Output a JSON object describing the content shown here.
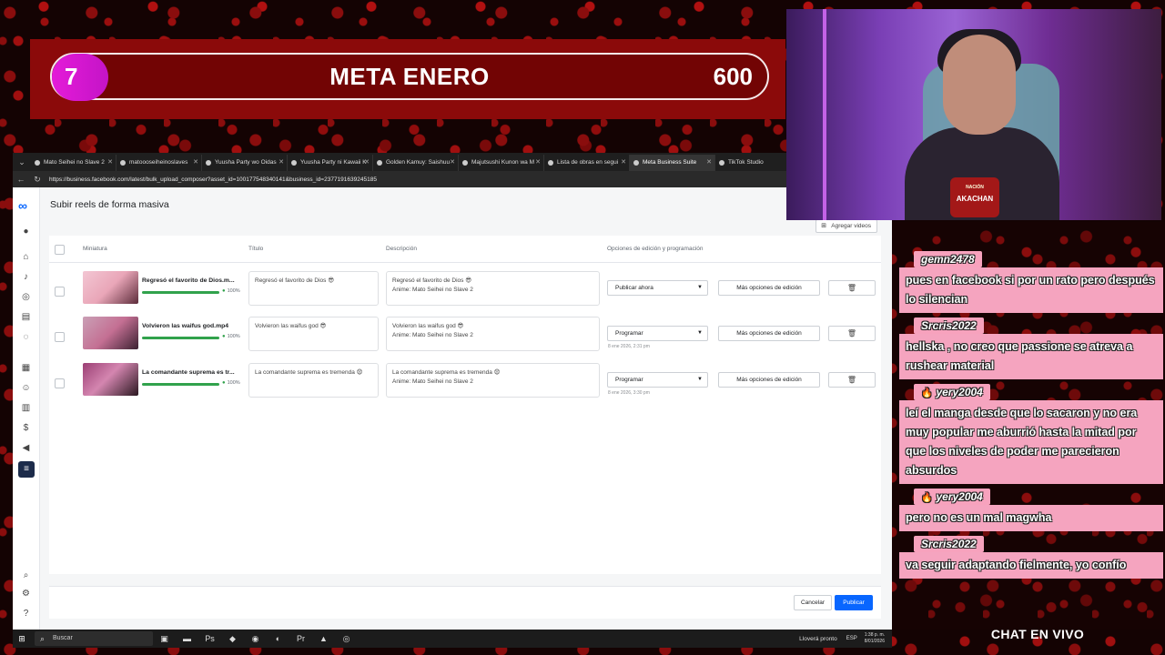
{
  "goal": {
    "current": "7",
    "title": "META ENERO",
    "target": "600"
  },
  "browser": {
    "tabs": [
      {
        "label": "Mato Seihei no Slave 2"
      },
      {
        "label": "matoooseiheinoslaves"
      },
      {
        "label": "Yuusha Party wo Oidas"
      },
      {
        "label": "Yuusha Party ni Kawaii K"
      },
      {
        "label": "Golden Kamuy: Saishuu"
      },
      {
        "label": "Majutsushi Kunon wa M"
      },
      {
        "label": "Lista de obras en segui"
      },
      {
        "label": "Meta Business Suite",
        "active": true
      },
      {
        "label": "TikTok Studio"
      }
    ],
    "url": "https://business.facebook.com/latest/bulk_upload_composer?asset_id=100177548340141&business_id=2377191639245185"
  },
  "page": {
    "title": "Subir reels de forma masiva",
    "add_videos": "Agregar videos",
    "columns": {
      "thumbnail": "Miniatura",
      "title": "Título",
      "description": "Descripción",
      "options": "Opciones de edición y programación"
    },
    "rows": [
      {
        "filename": "Regresó el favorito de Dios.m...",
        "progress": "100%",
        "title": "Regresó el favorito de Dios 😎",
        "description": "Regresó el favorito de Dios 😎\nAnime: Mato Seihei no Slave 2",
        "schedule": "Publicar ahora",
        "schedule_date": "",
        "more_options": "Más opciones de edición"
      },
      {
        "filename": "Volvieron las waifus god.mp4",
        "progress": "100%",
        "title": "Volvieron las waifus god 😎",
        "description": "Volvieron las waifus god 😎\nAnime: Mato Seihei no Slave 2",
        "schedule": "Programar",
        "schedule_date": "8 ene 2026, 2:31 pm",
        "more_options": "Más opciones de edición"
      },
      {
        "filename": "La comandante suprema es tr...",
        "progress": "100%",
        "title": "La comandante suprema es tremenda 😧",
        "description": "La comandante suprema es tremenda 😧\nAnime: Mato Seihei no Slave 2",
        "schedule": "Programar",
        "schedule_date": "8 ene 2026, 3:30 pm",
        "more_options": "Más opciones de edición"
      }
    ],
    "cancel": "Cancelar",
    "publish": "Publicar"
  },
  "taskbar": {
    "search": "Buscar",
    "weather": "Lloverá pronto",
    "lang": "ESP",
    "time": "1:38 p. m.",
    "date": "8/01/2026"
  },
  "cam": {
    "logo_top": "NACIÓN",
    "logo": "AKACHAN"
  },
  "chat": {
    "messages": [
      {
        "user": "gemn2478",
        "flame": false,
        "text": "pues en facebook si por un rato pero después lo silencian"
      },
      {
        "user": "Srcris2022",
        "flame": false,
        "text": "hellska , no creo que passione se atreva a rushear material"
      },
      {
        "user": "yery2004",
        "flame": true,
        "text": "leí el manga desde que lo sacaron y no era muy popular me aburrió hasta la mitad por que los niveles de poder me parecieron absurdos"
      },
      {
        "user": "yery2004",
        "flame": true,
        "text": "pero no es un mal magwha"
      },
      {
        "user": "Srcris2022",
        "flame": false,
        "text": "va seguir adaptando fielmente, yo confío"
      }
    ],
    "label": "CHAT EN VIVO"
  }
}
